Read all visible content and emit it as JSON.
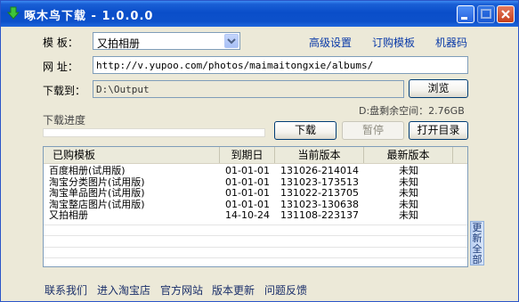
{
  "titlebar": {
    "title": "啄木鸟下载 - 1.0.0.0",
    "icon": "green-arrow-down-icon"
  },
  "form": {
    "template_label": "模  板：",
    "template_value": "又拍相册",
    "url_label": "网  址：",
    "url_value": "http://v.yupoo.com/photos/maimaitongxie/albums/",
    "download_to_label": "下载到：",
    "download_to_value": "D:\\Output",
    "browse_label": "浏览",
    "disk_free": "D:盘剩余空间：2.76GB",
    "progress_label": "下载进度",
    "progress_value": 0
  },
  "top_links": {
    "advanced_settings": "高级设置",
    "subscribe_template": "订购模板",
    "machine_code": "机器码"
  },
  "actions": {
    "download": "下载",
    "pause": "暂停",
    "open_dir": "打开目录"
  },
  "table": {
    "headers": [
      "已购模板",
      "到期日",
      "当前版本",
      "最新版本"
    ],
    "rows": [
      [
        "百度相册(试用版)",
        "01-01-01",
        "131026-214014",
        "未知"
      ],
      [
        "淘宝分类图片(试用版)",
        "01-01-01",
        "131023-173513",
        "未知"
      ],
      [
        "淘宝单品图片(试用版)",
        "01-01-01",
        "131022-213705",
        "未知"
      ],
      [
        "淘宝整店图片(试用版)",
        "01-01-01",
        "131023-130638",
        "未知"
      ],
      [
        "又拍相册",
        "14-10-24",
        "131108-223137",
        "未知"
      ]
    ]
  },
  "side_button": "更新全部",
  "footer": [
    "联系我们",
    "进入淘宝店",
    "官方网站",
    "版本更新",
    "问题反馈"
  ]
}
